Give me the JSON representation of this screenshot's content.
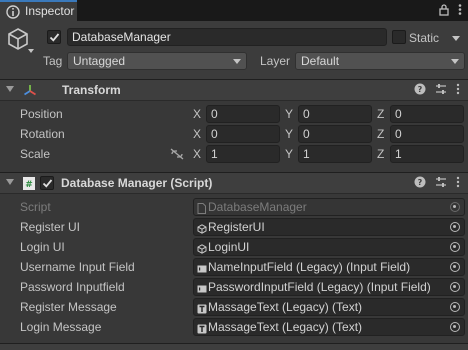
{
  "tab": {
    "title": "Inspector"
  },
  "object": {
    "name": "DatabaseManager",
    "static_label": "Static",
    "tag_label": "Tag",
    "tag_value": "Untagged",
    "layer_label": "Layer",
    "layer_value": "Default"
  },
  "transform": {
    "title": "Transform",
    "rows": [
      {
        "label": "Position",
        "x": "0",
        "y": "0",
        "z": "0"
      },
      {
        "label": "Rotation",
        "x": "0",
        "y": "0",
        "z": "0"
      },
      {
        "label": "Scale",
        "x": "1",
        "y": "1",
        "z": "1"
      }
    ],
    "axes": {
      "x": "X",
      "y": "Y",
      "z": "Z"
    }
  },
  "script_component": {
    "title": "Database Manager (Script)",
    "script_label": "Script",
    "script_value": "DatabaseManager",
    "fields": [
      {
        "label": "Register UI",
        "value": "RegisterUI",
        "icon": "gameobject-icon"
      },
      {
        "label": "Login UI",
        "value": "LoginUI",
        "icon": "gameobject-icon"
      },
      {
        "label": "Username Input Field",
        "value": "NameInputField (Legacy) (Input Field)",
        "icon": "inputfield-icon"
      },
      {
        "label": "Password Inputfield",
        "value": "PasswordInputField (Legacy) (Input Field)",
        "icon": "inputfield-icon"
      },
      {
        "label": "Register Message",
        "value": "MassageText (Legacy) (Text)",
        "icon": "text-icon"
      },
      {
        "label": "Login Message",
        "value": "MassageText (Legacy) (Text)",
        "icon": "text-icon"
      }
    ]
  },
  "colors": {
    "accent": "#3a79bb",
    "background": "#383838"
  }
}
